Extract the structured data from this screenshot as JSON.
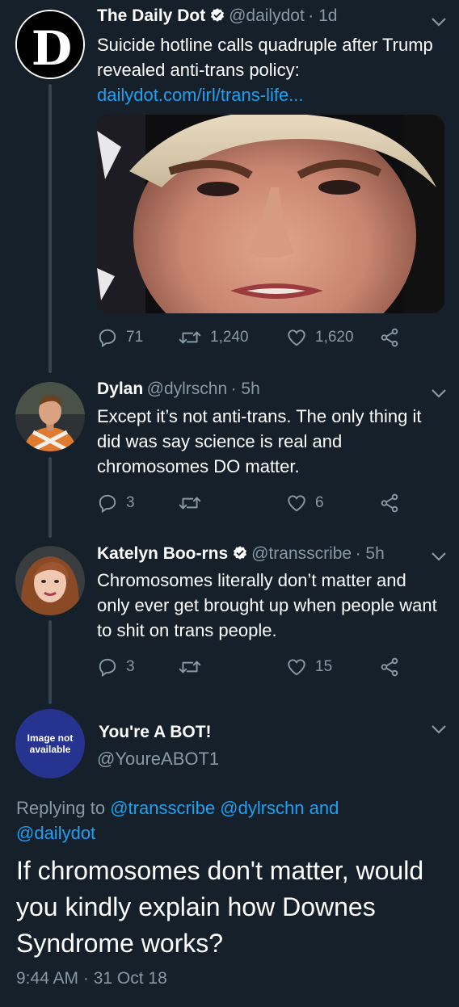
{
  "tweets": [
    {
      "name": "The Daily Dot",
      "verified": true,
      "handle": "@dailydot",
      "time": "· 1d",
      "text": "Suicide hotline calls quadruple after Trump revealed anti-trans policy:",
      "link": "dailydot.com/irl/trans-life...",
      "avatar_letter": "D",
      "replies": "71",
      "retweets": "1,240",
      "likes": "1,620"
    },
    {
      "name": "Dylan",
      "verified": false,
      "handle": "@dylrschn",
      "time": "· 5h",
      "text": "Except it’s not anti-trans. The only thing it did was say science is real and chromosomes DO matter.",
      "replies": "3",
      "retweets": "",
      "likes": "6"
    },
    {
      "name": "Katelyn Boo-rns",
      "verified": true,
      "handle": "@transscribe",
      "time": "· 5h",
      "text": "Chromosomes literally don’t matter and only ever get brought up when people want to shit on trans people.",
      "replies": "3",
      "retweets": "",
      "likes": "15"
    }
  ],
  "main_tweet": {
    "name": "You're A BOT!",
    "handle": "@YoureABOT1",
    "avatar_text": "Image not available",
    "replying_prefix": "Replying to",
    "replying_to": [
      "@transscribe",
      "@dylrschn",
      "and",
      "@dailydot"
    ],
    "text": "If chromosomes don't matter, would you kindly explain how Downes Syndrome works?",
    "timestamp": "9:44 AM · 31 Oct 18"
  },
  "colors": {
    "background": "#15202b",
    "secondary_text": "#8899a6",
    "link": "#1da1f2",
    "thread_line": "#38444d"
  }
}
